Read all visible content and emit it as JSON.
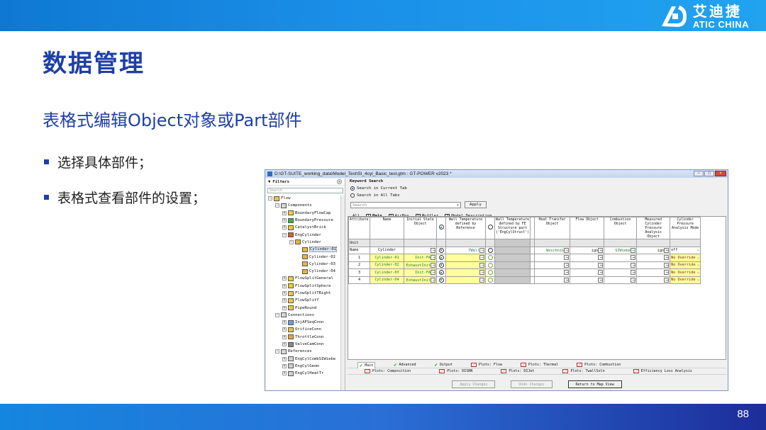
{
  "slide": {
    "title": "数据管理",
    "subtitle": "表格式编辑Object对象或Part部件",
    "bullets": [
      "选择具体部件；",
      "表格式查看部件的设置；"
    ],
    "page_number": "88",
    "logo": {
      "cn": "艾迪捷",
      "en": "ATIC CHINA"
    },
    "colors": {
      "brand_blue": "#1f3fa8",
      "bar_blue": "#1a8fe8"
    }
  },
  "window": {
    "title": "D:\\GT-SUITE_working_data\\Model_Test\\SI_4cyl_Basic_test.gtm : GT-POWER v2023 *",
    "buttons": {
      "minimize": "−",
      "maximize": "□",
      "close": "×"
    }
  },
  "tree": {
    "filters_label": "Filters",
    "search_placeholder": "Search",
    "items": [
      {
        "label": "Flow",
        "level": 0,
        "pm": "−",
        "color": "#e8c43a"
      },
      {
        "label": "Components",
        "level": 1,
        "pm": "−",
        "color": "#d8d8d8"
      },
      {
        "label": "BoundaryFlowCap",
        "level": 2,
        "pm": "+",
        "color": "#f0d040"
      },
      {
        "label": "BoundaryPressure",
        "level": 2,
        "pm": "+",
        "color": "#3ab04a"
      },
      {
        "label": "CatalystBrick",
        "level": 2,
        "pm": "+",
        "color": "#f4c830"
      },
      {
        "label": "EngCylinder",
        "level": 2,
        "pm": "−",
        "color": "#e05a2a"
      },
      {
        "label": "Cylinder",
        "level": 3,
        "pm": "−",
        "color": "#e8b43a"
      },
      {
        "label": "Cylinder-01",
        "level": 4,
        "pm": "",
        "color": "#e8b43a",
        "selected": true
      },
      {
        "label": "Cylinder-02",
        "level": 4,
        "pm": "",
        "color": "#e8b43a"
      },
      {
        "label": "Cylinder-03",
        "level": 4,
        "pm": "",
        "color": "#e8b43a"
      },
      {
        "label": "Cylinder-04",
        "level": 4,
        "pm": "",
        "color": "#e8b43a"
      },
      {
        "label": "FlowSplitGeneral",
        "level": 2,
        "pm": "+",
        "color": "#f0c840"
      },
      {
        "label": "FlowSplitSphere",
        "level": 2,
        "pm": "+",
        "color": "#f0c840"
      },
      {
        "label": "FlowSplitTRight",
        "level": 2,
        "pm": "+",
        "color": "#f0c840"
      },
      {
        "label": "FlowSplitY",
        "level": 2,
        "pm": "+",
        "color": "#f0c840"
      },
      {
        "label": "PipeRound",
        "level": 2,
        "pm": "+",
        "color": "#f0c840"
      },
      {
        "label": "Connections",
        "level": 1,
        "pm": "−",
        "color": "#d8d8d8"
      },
      {
        "label": "InjAFSeqConn",
        "level": 2,
        "pm": "+",
        "color": "#6aa0d8"
      },
      {
        "label": "OrificeConn",
        "level": 2,
        "pm": "+",
        "color": "#e8c43a"
      },
      {
        "label": "ThrottleConn",
        "level": 2,
        "pm": "+",
        "color": "#e8a43a"
      },
      {
        "label": "ValveCamConn",
        "level": 2,
        "pm": "+",
        "color": "#888888"
      },
      {
        "label": "References",
        "level": 1,
        "pm": "−",
        "color": "#d8d8d8"
      },
      {
        "label": "EngCylCombSIWiebe",
        "level": 2,
        "pm": "+",
        "color": "#d0d0d0"
      },
      {
        "label": "EngCylGeom",
        "level": 2,
        "pm": "+",
        "color": "#d0d0d0"
      },
      {
        "label": "EngCylHeatTr",
        "level": 2,
        "pm": "+",
        "color": "#d0d0d0"
      }
    ]
  },
  "keyword_search": {
    "label": "Keyword Search",
    "option_current": "Search in Current Tab",
    "option_all": "Search in All Tabs",
    "search_placeholder": "Search",
    "clear": "×",
    "apply_label": "Apply"
  },
  "tabs": [
    {
      "num": "",
      "label": "All"
    },
    {
      "num": "1",
      "label": "Main",
      "active": true
    },
    {
      "num": "2",
      "label": "AirBox"
    },
    {
      "num": "2",
      "label": "Muffler"
    },
    {
      "num": "2",
      "label": "Model_Description"
    }
  ],
  "grid": {
    "headers": {
      "attribute": "Attribute",
      "name": "Name",
      "init_state": "Initial State Object",
      "wall_temp_ref": "Wall Temperature defined by Reference",
      "wall_temp_fe": "Wall Temperature defined by FE Structure part ('EngCylStruct')",
      "heat_transfer": "Heat Transfer Object",
      "flow_object": "Flow Object",
      "combustion": "Combustion Object",
      "measured_pressure": "Measured Cylinder Pressure Analysis Object",
      "pressure_mode": "Cylinder Pressure Analysis Mode"
    },
    "unit_label": "Unit",
    "name_row": {
      "attr": "Name",
      "name": "Cylinder",
      "init": "",
      "twall": "TWall",
      "heat": "WoschniG",
      "flow": "ign",
      "comb": "SIWiebe",
      "meas": "ign",
      "mode": "off"
    },
    "rows": [
      {
        "idx": "1",
        "name": "Cylinder-01",
        "init": "Init-FA",
        "mode": "No Override"
      },
      {
        "idx": "2",
        "name": "Cylinder-02",
        "init": "ExhaustInit",
        "mode": "No Override"
      },
      {
        "idx": "3",
        "name": "Cylinder-03",
        "init": "Init-FA",
        "mode": "No Override"
      },
      {
        "idx": "4",
        "name": "Cylinder-04",
        "init": "ExhaustInit",
        "mode": "No Override"
      }
    ]
  },
  "bottom_tabs": {
    "row1": [
      {
        "label": "Main",
        "kind": "check",
        "active": true
      },
      {
        "label": "Advanced",
        "kind": "check"
      },
      {
        "label": "Output",
        "kind": "check"
      },
      {
        "label": "Plots: Flow",
        "kind": "plot"
      },
      {
        "label": "Plots: Thermal",
        "kind": "plot"
      },
      {
        "label": "Plots: Combustion",
        "kind": "plot"
      }
    ],
    "row2": [
      {
        "label": "Plots: Composition",
        "kind": "plot"
      },
      {
        "label": "Plots: DISRN",
        "kind": "plot"
      },
      {
        "label": "Plots: DIJet",
        "kind": "plot"
      },
      {
        "label": "Plots: TwallSoln",
        "kind": "plot"
      },
      {
        "label": "Efficiency Loss Analysis",
        "kind": "plot"
      }
    ]
  },
  "actions": {
    "apply_changes": "Apply Changes",
    "undo_changes": "Undo Changes",
    "return_to_map": "Return to Map View"
  }
}
